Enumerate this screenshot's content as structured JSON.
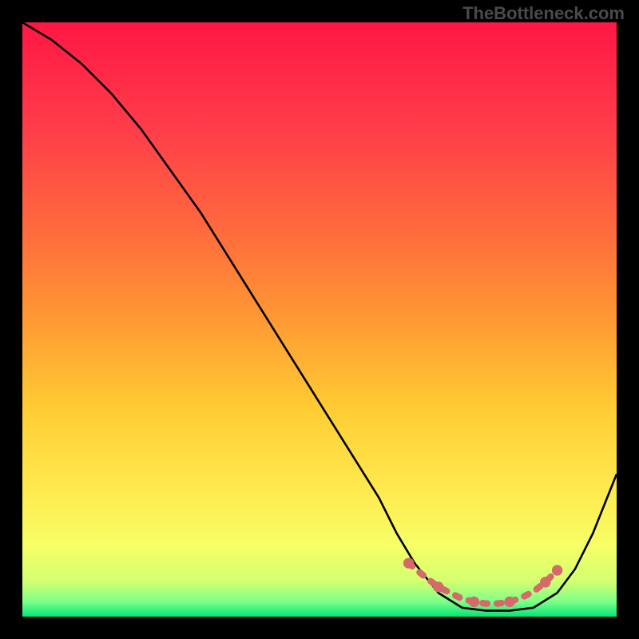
{
  "watermark": "TheBottleneck.com",
  "chart_data": {
    "type": "line",
    "title": "",
    "xlabel": "",
    "ylabel": "",
    "xlim": [
      0,
      100
    ],
    "ylim": [
      0,
      100
    ],
    "series": [
      {
        "name": "curve",
        "x": [
          0,
          5,
          10,
          15,
          20,
          25,
          30,
          35,
          40,
          45,
          50,
          55,
          60,
          63,
          66,
          70,
          74,
          78,
          82,
          86,
          90,
          93,
          96,
          100
        ],
        "y": [
          100,
          97,
          93,
          88,
          82,
          75,
          68,
          60,
          52,
          44,
          36,
          28,
          20,
          14,
          9,
          4,
          1.5,
          1,
          1,
          1.5,
          4,
          8,
          14,
          24
        ],
        "color": "#000000"
      },
      {
        "name": "optimal-range-markers",
        "x": [
          65,
          68,
          70,
          72,
          74,
          76,
          78,
          80,
          82,
          84,
          86,
          88,
          90
        ],
        "y": [
          9,
          6.5,
          5,
          4,
          3,
          2.5,
          2.2,
          2.2,
          2.5,
          3.2,
          4.2,
          5.8,
          7.8
        ],
        "color": "#d46a6a",
        "marker": "dot"
      }
    ],
    "background_gradient": {
      "type": "vertical",
      "stops": [
        {
          "pos": 0.0,
          "color": "#ff1744"
        },
        {
          "pos": 0.18,
          "color": "#ff3d4a"
        },
        {
          "pos": 0.35,
          "color": "#ff6a3d"
        },
        {
          "pos": 0.5,
          "color": "#ff9933"
        },
        {
          "pos": 0.65,
          "color": "#ffcc33"
        },
        {
          "pos": 0.78,
          "color": "#ffe84d"
        },
        {
          "pos": 0.88,
          "color": "#f7ff66"
        },
        {
          "pos": 0.94,
          "color": "#d4ff70"
        },
        {
          "pos": 0.975,
          "color": "#7dff8a"
        },
        {
          "pos": 1.0,
          "color": "#00e676"
        }
      ]
    }
  }
}
